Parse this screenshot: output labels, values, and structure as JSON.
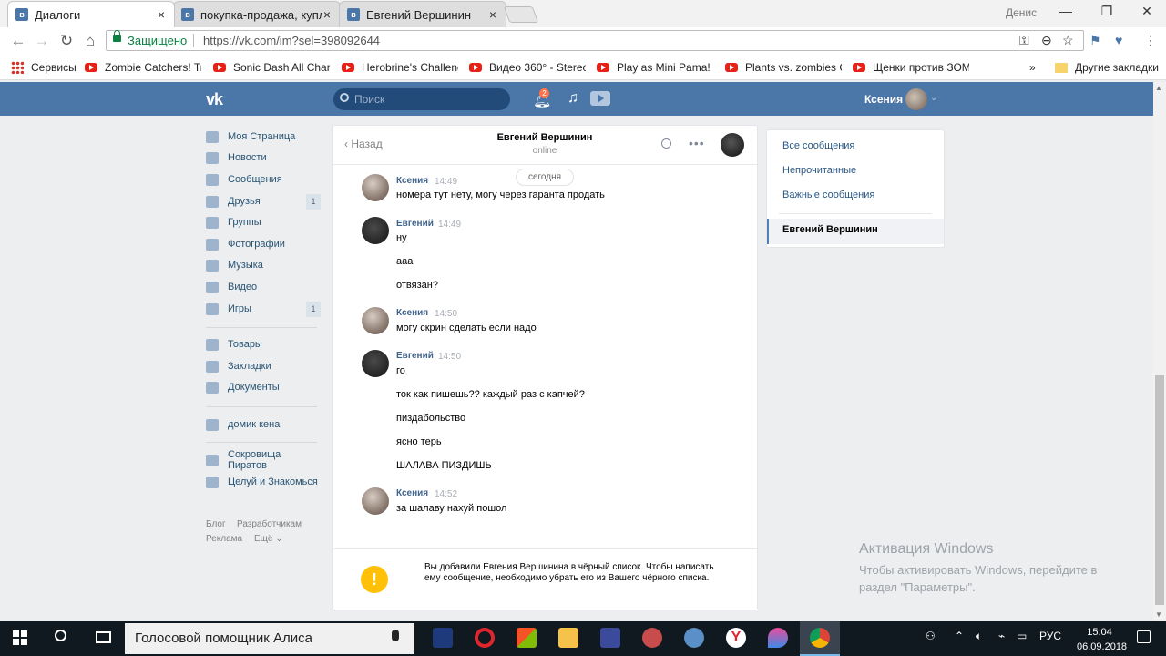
{
  "browser": {
    "tabs": [
      {
        "title": "Диалоги",
        "active": true
      },
      {
        "title": "покупка-продажа, купл",
        "active": false
      },
      {
        "title": "Евгений Вершинин",
        "active": false
      }
    ],
    "profile_name": "Денис",
    "secure_label": "Защищено",
    "url": "https://vk.com/im?sel=398092644",
    "bookmarks": [
      "Сервисы",
      "Zombie Catchers! Tra",
      "Sonic Dash All Chara",
      "Herobrine's Challeng",
      "Видео 360° - Stereo",
      "Play as Mini Pama! M",
      "Plants vs. zombies CA",
      "Щенки против ЗОМ"
    ],
    "more_bookmarks": "»",
    "other_bookmarks": "Другие закладки"
  },
  "vk": {
    "logo": "vk",
    "search_placeholder": "Поиск",
    "notification_count": "2",
    "user_name": "Ксения"
  },
  "sidebar": {
    "items": [
      {
        "label": "Моя Страница",
        "count": ""
      },
      {
        "label": "Новости",
        "count": ""
      },
      {
        "label": "Сообщения",
        "count": ""
      },
      {
        "label": "Друзья",
        "count": "1"
      },
      {
        "label": "Группы",
        "count": ""
      },
      {
        "label": "Фотографии",
        "count": ""
      },
      {
        "label": "Музыка",
        "count": ""
      },
      {
        "label": "Видео",
        "count": ""
      },
      {
        "label": "Игры",
        "count": "1"
      }
    ],
    "items2": [
      "Товары",
      "Закладки",
      "Документы"
    ],
    "items3": [
      "домик кена"
    ],
    "items4": [
      "Сокровища Пиратов",
      "Целуй и Знакомься"
    ],
    "footer": [
      "Блог",
      "Разработчикам",
      "Реклама",
      "Ещё ⌄"
    ]
  },
  "conversation": {
    "back_label": "Назад",
    "name": "Евгений Вершинин",
    "status": "online",
    "date_divider": "сегодня",
    "groups": [
      {
        "author": "Ксения",
        "time": "14:49",
        "messages": [
          "номера тут нету, могу через гаранта продать"
        ]
      },
      {
        "author": "Евгений",
        "time": "14:49",
        "messages": [
          "ну",
          "ааа",
          "отвязан?"
        ]
      },
      {
        "author": "Ксения",
        "time": "14:50",
        "messages": [
          "могу скрин сделать если надо"
        ]
      },
      {
        "author": "Евгений",
        "time": "14:50",
        "messages": [
          "го",
          "ток как пишешь?? каждый раз с капчей?",
          "пиздабольство",
          "ясно терь",
          "ШАЛАВА ПИЗДИШЬ"
        ]
      },
      {
        "author": "Ксения",
        "time": "14:52",
        "messages": [
          "за шалаву нахуй пошол"
        ]
      }
    ],
    "blacklist_notice": "Вы добавили Евгения Вершинина в чёрный список. Чтобы написать ему сообщение, необходимо убрать его из Вашего чёрного списка."
  },
  "right_menu": {
    "items": [
      "Все сообщения",
      "Непрочитанные",
      "Важные сообщения"
    ],
    "active": "Евгений Вершинин"
  },
  "watermark": {
    "title": "Активация Windows",
    "text": "Чтобы активировать Windows, перейдите в раздел \"Параметры\"."
  },
  "taskbar": {
    "search_text": "Голосовой помощник Алиса",
    "language": "РУС",
    "time": "15:04",
    "date": "06.09.2018"
  },
  "colors": {
    "vk_blue": "#4a76a8",
    "link": "#2a5885",
    "author": "#42648b",
    "warning": "#ffc107"
  }
}
